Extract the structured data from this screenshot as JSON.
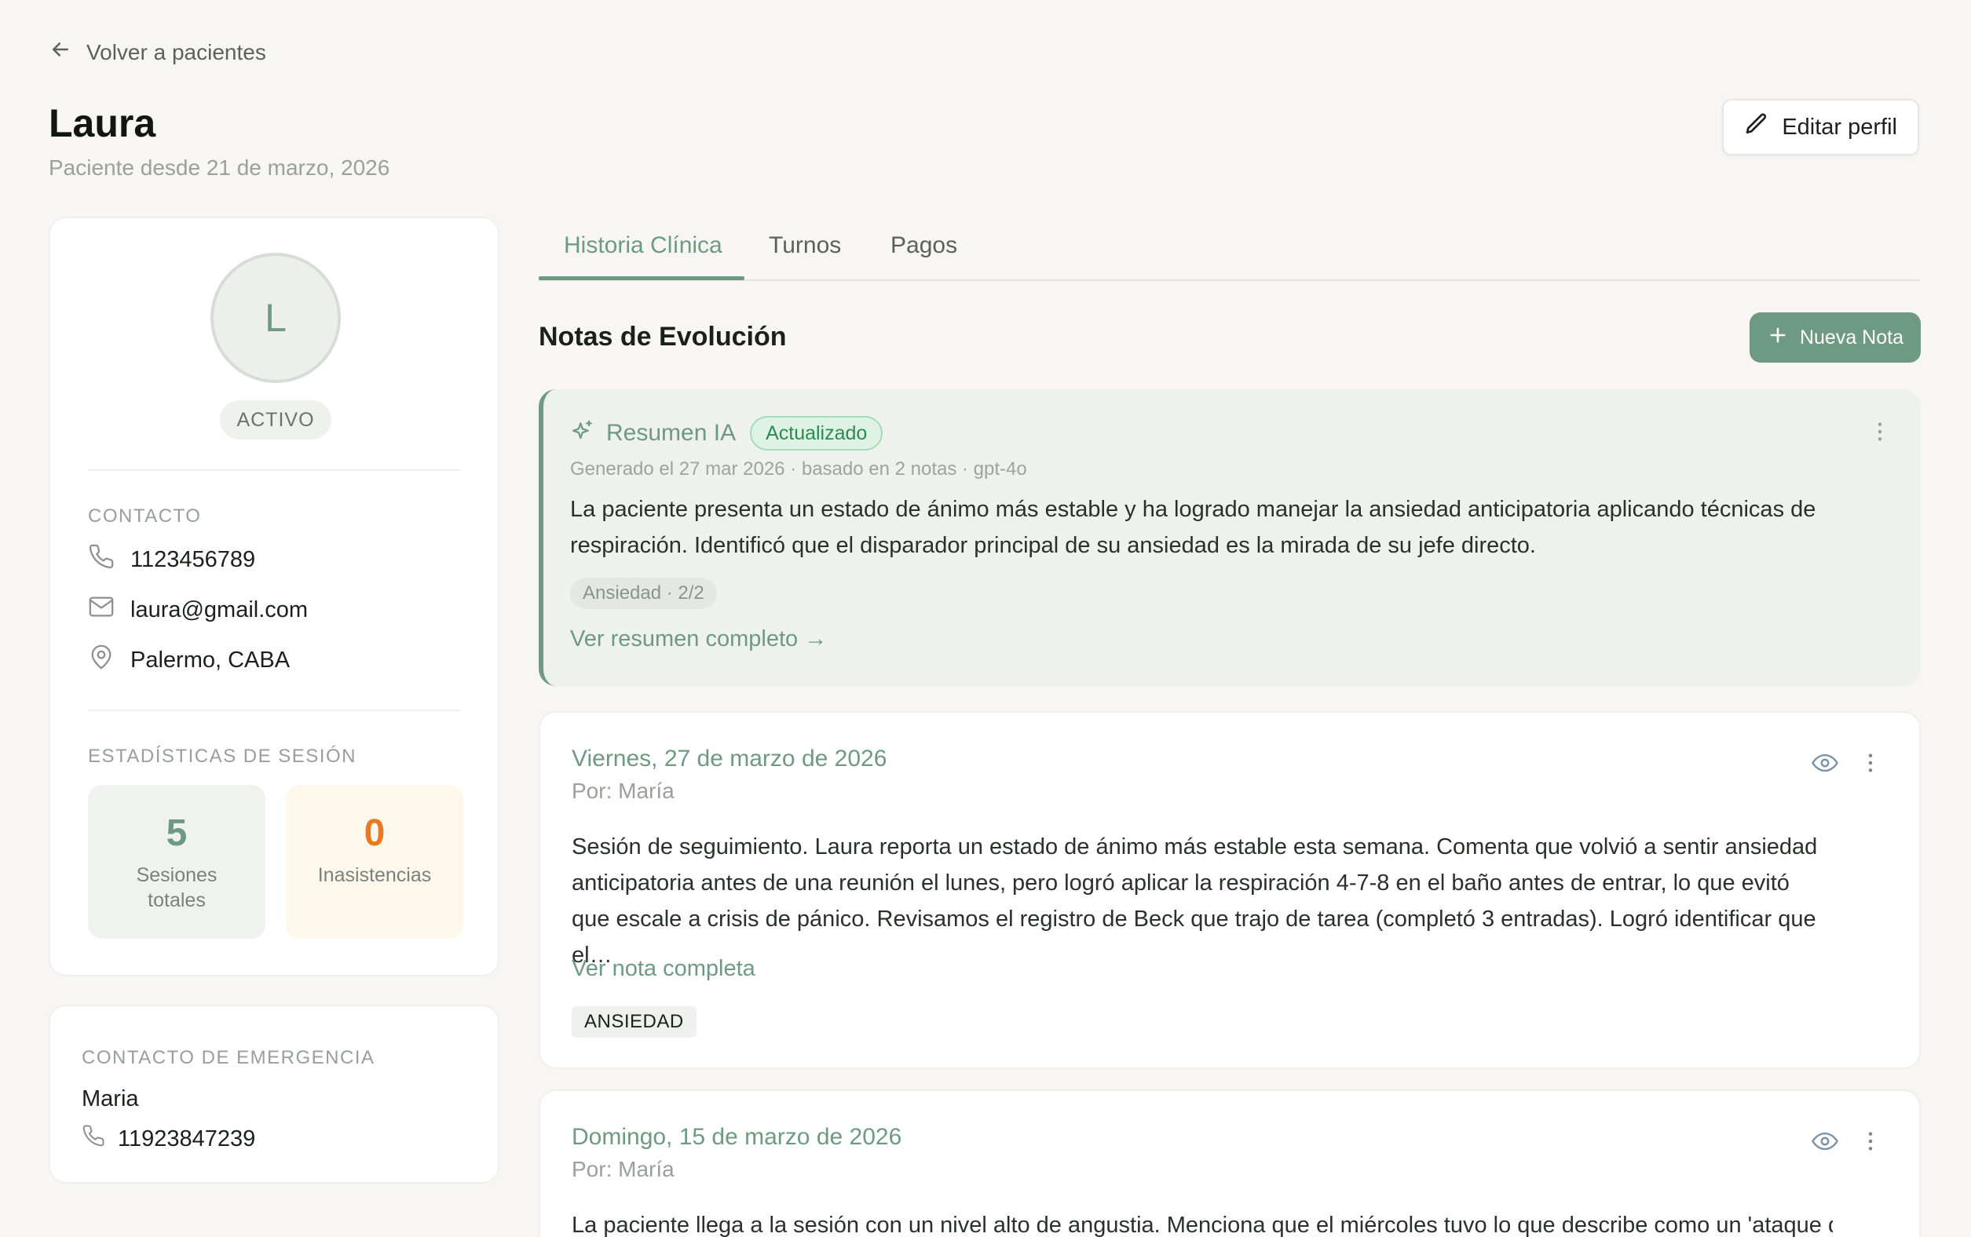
{
  "nav": {
    "back_label": "Volver a pacientes"
  },
  "header": {
    "title": "Laura",
    "subtitle": "Paciente desde 21 de marzo, 2026",
    "edit_label": "Editar perfil"
  },
  "profile": {
    "avatar_initial": "L",
    "status": "ACTIVO",
    "contact_label": "CONTACTO",
    "phone": "1123456789",
    "email": "laura@gmail.com",
    "location": "Palermo, CABA",
    "stats_label": "ESTADÍSTICAS DE SESIÓN",
    "stats": {
      "total_value": "5",
      "total_label": "Sesiones totales",
      "missed_value": "0",
      "missed_label": "Inasistencias"
    }
  },
  "emergency": {
    "label": "CONTACTO DE EMERGENCIA",
    "name": "Maria",
    "phone": "11923847239"
  },
  "tabs": [
    {
      "label": "Historia Clínica",
      "active": true
    },
    {
      "label": "Turnos",
      "active": false
    },
    {
      "label": "Pagos",
      "active": false
    }
  ],
  "notes_section": {
    "title": "Notas de Evolución",
    "new_note_label": "Nueva Nota"
  },
  "ai_summary": {
    "title": "Resumen IA",
    "badge": "Actualizado",
    "meta": "Generado el 27 mar 2026 · basado en 2 notas · gpt-4o",
    "body": "La paciente presenta un estado de ánimo más estable y ha logrado manejar la ansiedad anticipatoria aplicando técnicas de respiración. Identificó que el disparador principal de su ansiedad es la mirada de su jefe directo.",
    "tag": "Ansiedad · 2/2",
    "link": "Ver resumen completo →"
  },
  "notes": [
    {
      "date": "Viernes, 27 de marzo de 2026",
      "author": "Por: María",
      "body": "Sesión de seguimiento. Laura reporta un estado de ánimo más estable esta semana. Comenta que volvió a sentir ansiedad anticipatoria antes de una reunión el lunes, pero logró aplicar la respiración 4-7-8 en el baño antes de entrar, lo que evitó que escale a crisis de pánico. Revisamos el registro de Beck que trajo de tarea (completó 3 entradas). Logró identificar que el…",
      "link": "Ver nota completa",
      "tag": "ANSIEDAD"
    },
    {
      "date": "Domingo, 15 de marzo de 2026",
      "author": "Por: María",
      "body": "La paciente llega a la sesión con un nivel alto de angustia. Menciona que el miércoles tuvo lo que describe como un 'ataque de"
    }
  ],
  "colors": {
    "accent": "#6e9a83",
    "background": "#f7f6f3",
    "missed": "#ea7a22",
    "badge_green": "#2d8a52"
  }
}
